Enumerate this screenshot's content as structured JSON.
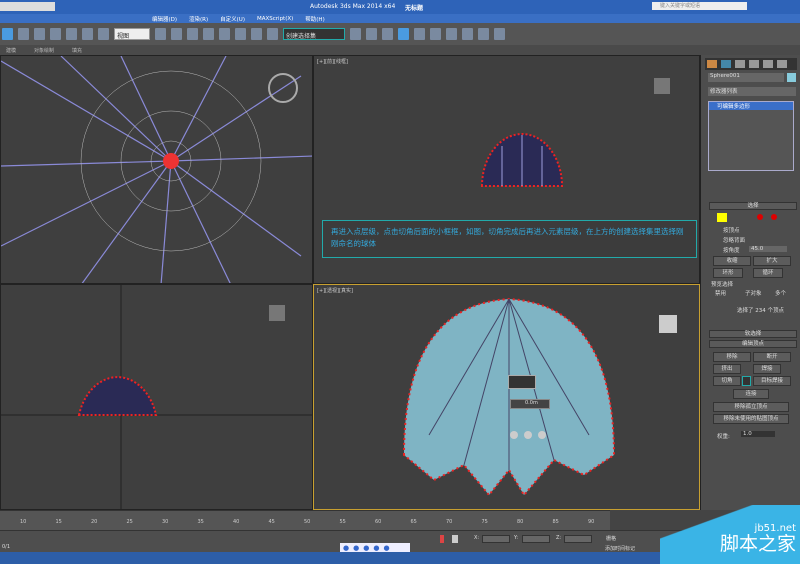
{
  "window": {
    "title": "Autodesk 3ds Max  2014 x64",
    "doc": "无标题",
    "search_placeholder": "键入关键字或短语"
  },
  "menu": [
    "编辑器(D)",
    "渲染(R)",
    "自定义(U)",
    "MAXScript(X)",
    "帮助(H)"
  ],
  "toolbar": {
    "view_dropdown": "视图",
    "selection_set": "创建选择集"
  },
  "ribbon": [
    "建模",
    "对象绘制",
    "填充"
  ],
  "viewports": {
    "top_left": "",
    "top_right": "[+][前][线框]",
    "bottom_left": "",
    "perspective": "[+][透视][真实]"
  },
  "note": "再进入点层级，点击切角后面的小框框，如图，切角完成后再进入元素层级，在上方的创建选择集里选择刚刚命名的球体",
  "caddy": {
    "value": "0.0m"
  },
  "panel": {
    "object_name": "Sphere001",
    "modifier_list": "修改器列表",
    "stack_item": "可编辑多边形",
    "selection_header": "选择",
    "by_vertex": "按顶点",
    "ignore_backfacing": "忽略背面",
    "by_angle": "按角度",
    "angle_value": "45.0",
    "shrink": "收缩",
    "grow": "扩大",
    "ring": "环形",
    "loop": "循环",
    "preview_label": "预览选择",
    "preview_options": [
      "禁用",
      "子对象",
      "多个"
    ],
    "selected_info": "选择了 234 个顶点",
    "soft_selection": "软选择",
    "edit_vertices": "编辑顶点",
    "remove": "移除",
    "break": "断开",
    "extrude": "挤出",
    "weld": "焊接",
    "chamfer": "切角",
    "target_weld": "目标焊接",
    "connect": "连接",
    "remove_isolated": "移除孤立顶点",
    "remove_unused_map": "移除未使用的贴图顶点",
    "weight_label": "权重:",
    "weight_value": "1.0"
  },
  "timeline": {
    "ticks": [
      "10",
      "15",
      "20",
      "25",
      "30",
      "35",
      "40",
      "45",
      "50",
      "55",
      "60",
      "65",
      "70",
      "75",
      "80",
      "85",
      "90"
    ]
  },
  "status": {
    "x_label": "X:",
    "y_label": "Y:",
    "z_label": "Z:",
    "grid": "栅格",
    "add_time_tag": "添加时间标记",
    "frame": "0/1"
  },
  "watermark": {
    "site": "jb51.net",
    "name": "脚本之家"
  }
}
